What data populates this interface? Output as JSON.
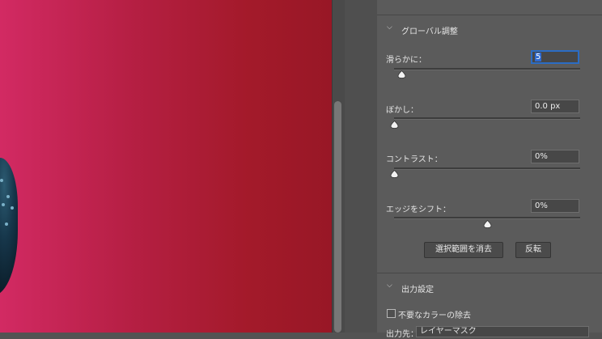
{
  "global_adjust": {
    "title": "グローバル調整",
    "smooth": {
      "label": "滑らかに：",
      "value": "5",
      "level": 0.04
    },
    "feather": {
      "label": "ぼかし：",
      "value": "0.0 px",
      "level": 0.0
    },
    "contrast": {
      "label": "コントラスト：",
      "value": "0%",
      "level": 0.0
    },
    "shift_edge": {
      "label": "エッジをシフト：",
      "value": "0%",
      "level": 0.5
    },
    "clear_selection_button": "選択範囲を消去",
    "invert_button": "反転"
  },
  "output_settings": {
    "title": "出力設定",
    "decontaminate_label": "不要なカラーの除去",
    "decontaminate_checked": false,
    "output_to_label": "出力先：",
    "output_to_value": "レイヤーマスク"
  }
}
